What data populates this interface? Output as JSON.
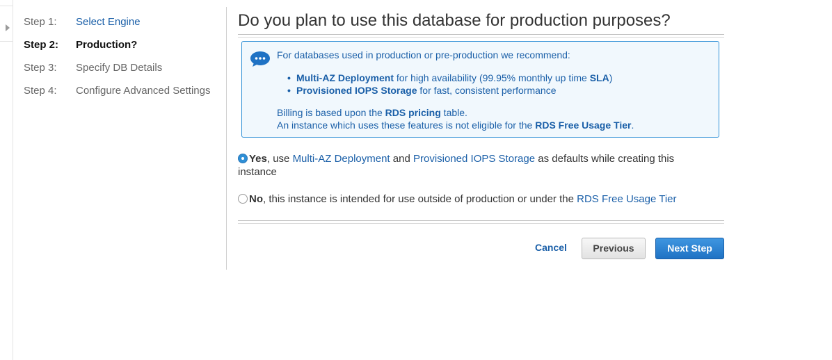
{
  "steps": [
    {
      "num": "Step 1:",
      "label": "Select Engine",
      "state": "done"
    },
    {
      "num": "Step 2:",
      "label": "Production?",
      "state": "active"
    },
    {
      "num": "Step 3:",
      "label": "Specify DB Details",
      "state": "pending"
    },
    {
      "num": "Step 4:",
      "label": "Configure Advanced Settings",
      "state": "pending"
    }
  ],
  "page_title": "Do you plan to use this database for production purposes?",
  "info": {
    "intro": "For databases used in production or pre-production we recommend:",
    "items": [
      {
        "bold": "Multi-AZ Deployment",
        "text": " for high availability (99.95% monthly up time ",
        "bold2": "SLA",
        "tail": ")"
      },
      {
        "bold": "Provisioned IOPS Storage",
        "text": " for fast, consistent performance"
      }
    ],
    "billing_prefix": "Billing is based upon the ",
    "billing_link": "RDS pricing",
    "billing_suffix": " table.",
    "eligibility_prefix": "An instance which uses these features is not eligible for the ",
    "eligibility_link": "RDS Free Usage Tier",
    "eligibility_suffix": "."
  },
  "options": {
    "yes": {
      "bold": "Yes",
      "text1": ", use ",
      "link1": "Multi-AZ Deployment",
      "text2": " and ",
      "link2": "Provisioned IOPS Storage",
      "text3": " as defaults while creating this instance",
      "selected": true
    },
    "no": {
      "bold": "No",
      "text1": ", this instance is intended for use outside of production or under the ",
      "link1": "RDS Free Usage Tier",
      "selected": false
    }
  },
  "buttons": {
    "cancel": "Cancel",
    "previous": "Previous",
    "next": "Next Step"
  },
  "colors": {
    "link": "#1a5fa8",
    "info_bg": "#f1f8fd",
    "info_border": "#2e8fd6",
    "primary_button": "#2678cc"
  }
}
